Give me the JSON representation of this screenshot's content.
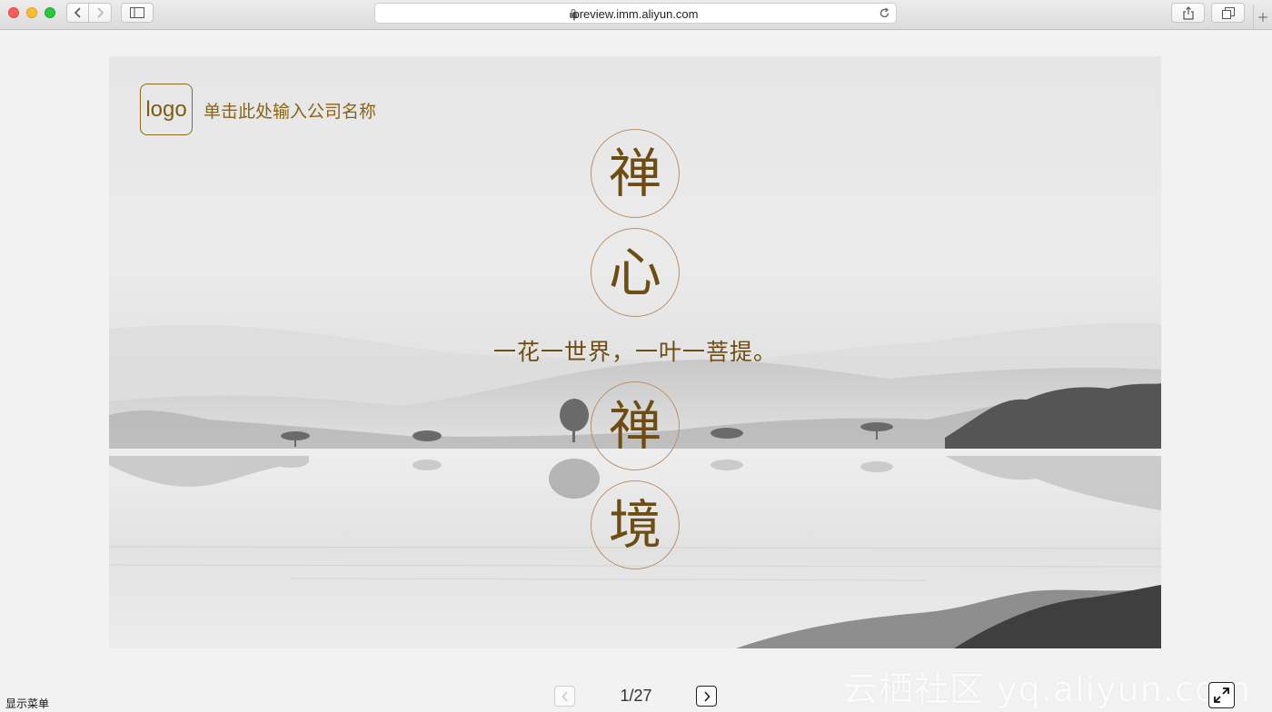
{
  "browser": {
    "url": "preview.imm.aliyun.com"
  },
  "slide": {
    "logo": "logo",
    "company_name": "单击此处输入公司名称",
    "circles": [
      "禅",
      "心",
      "禅",
      "境"
    ],
    "tagline": "一花一世界，一叶一菩提。"
  },
  "footer": {
    "menu_label": "显示菜单",
    "page_indicator": "1/27",
    "watermark": "云栖社区 yq.aliyun.com"
  },
  "colors": {
    "accent_gold": "#6e4d12",
    "circle_border": "#b8906b"
  }
}
